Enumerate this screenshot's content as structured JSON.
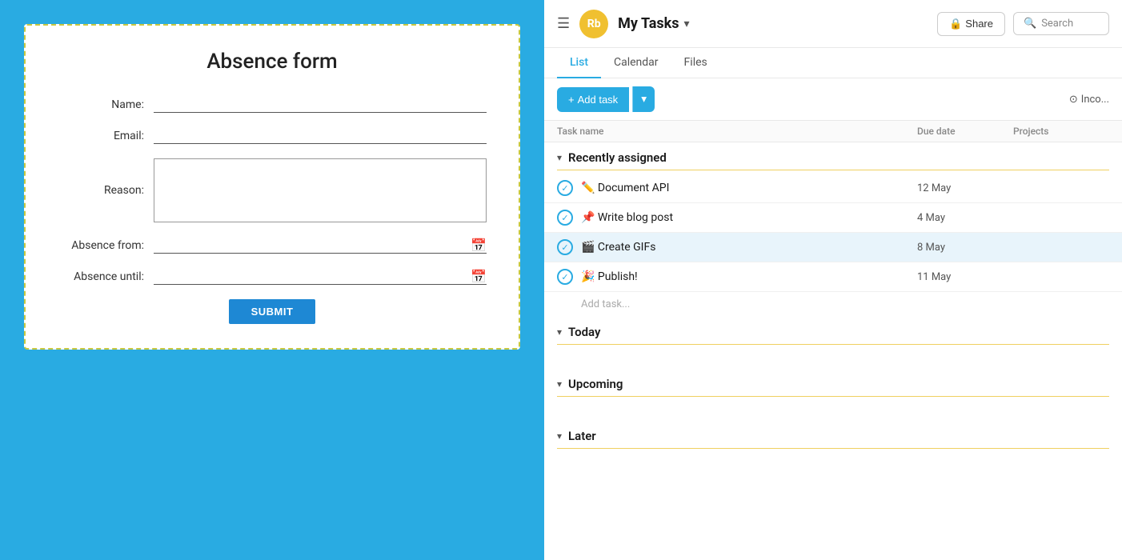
{
  "left": {
    "form_title": "Absence form",
    "fields": {
      "name_label": "Name:",
      "email_label": "Email:",
      "reason_label": "Reason:",
      "absence_from_label": "Absence from:",
      "absence_until_label": "Absence until:"
    },
    "submit_label": "SUBMIT"
  },
  "right": {
    "header": {
      "menu_label": "☰",
      "avatar_initials": "Rb",
      "title": "My Tasks",
      "share_label": "Share",
      "search_placeholder": "Search"
    },
    "tabs": [
      {
        "label": "List",
        "active": true
      },
      {
        "label": "Calendar",
        "active": false
      },
      {
        "label": "Files",
        "active": false
      }
    ],
    "action_bar": {
      "add_task_label": "+ Add task",
      "incomplete_label": "Inco..."
    },
    "table_headers": {
      "task_name": "Task name",
      "due_date": "Due date",
      "projects": "Projects"
    },
    "sections": [
      {
        "title": "Recently assigned",
        "tasks": [
          {
            "name": "✏️ Document API",
            "due": "12 May",
            "done": true
          },
          {
            "name": "📌 Write blog post",
            "due": "4 May",
            "done": true
          },
          {
            "name": "🎬 Create GIFs",
            "due": "8 May",
            "done": true,
            "highlighted": true
          },
          {
            "name": "🎉 Publish!",
            "due": "11 May",
            "done": true
          }
        ],
        "add_task_label": "Add task..."
      },
      {
        "title": "Today",
        "tasks": []
      },
      {
        "title": "Upcoming",
        "tasks": []
      },
      {
        "title": "Later",
        "tasks": []
      }
    ]
  }
}
